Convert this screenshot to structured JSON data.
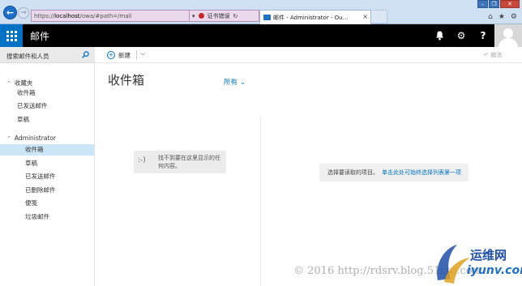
{
  "browser": {
    "address_prefix": "https://",
    "address_host": "localhost",
    "address_path": "/owa/#path=/mail",
    "cert_error": "证书错误",
    "tab_title": "邮件 - Administrator - Ou...",
    "tab_close": "×"
  },
  "suite": {
    "app_title": "邮件",
    "help_label": "?"
  },
  "search": {
    "placeholder": "搜索邮件和人员"
  },
  "command_bar": {
    "new_label": "新建",
    "undo_label": "撤消"
  },
  "nav": {
    "favorites": {
      "label": "收藏夹",
      "items": [
        "收件箱",
        "已发送邮件",
        "草稿"
      ]
    },
    "account": {
      "label": "Administrator",
      "items": [
        "收件箱",
        "草稿",
        "已发送邮件",
        "已删除邮件",
        "便笺",
        "垃圾邮件"
      ],
      "selected_index": 0
    }
  },
  "message_list": {
    "folder_title": "收件箱",
    "filter_label": "所有",
    "empty_emoticon": ":-)",
    "empty_text": "找不到要在这里显示的任何内容。"
  },
  "reading_pane": {
    "prompt_text": "选择要读取的项目。",
    "link_text": "单击此处可始终选择列表第一项"
  },
  "watermark": {
    "text": "© 2016 http://rdsrv.blog.51cto.com",
    "logo_main": "运维网",
    "logo_sub": "iyunv.com"
  },
  "colors": {
    "brand": "#0072c6",
    "suitebar": "#000000",
    "selected": "#cde6f7"
  }
}
